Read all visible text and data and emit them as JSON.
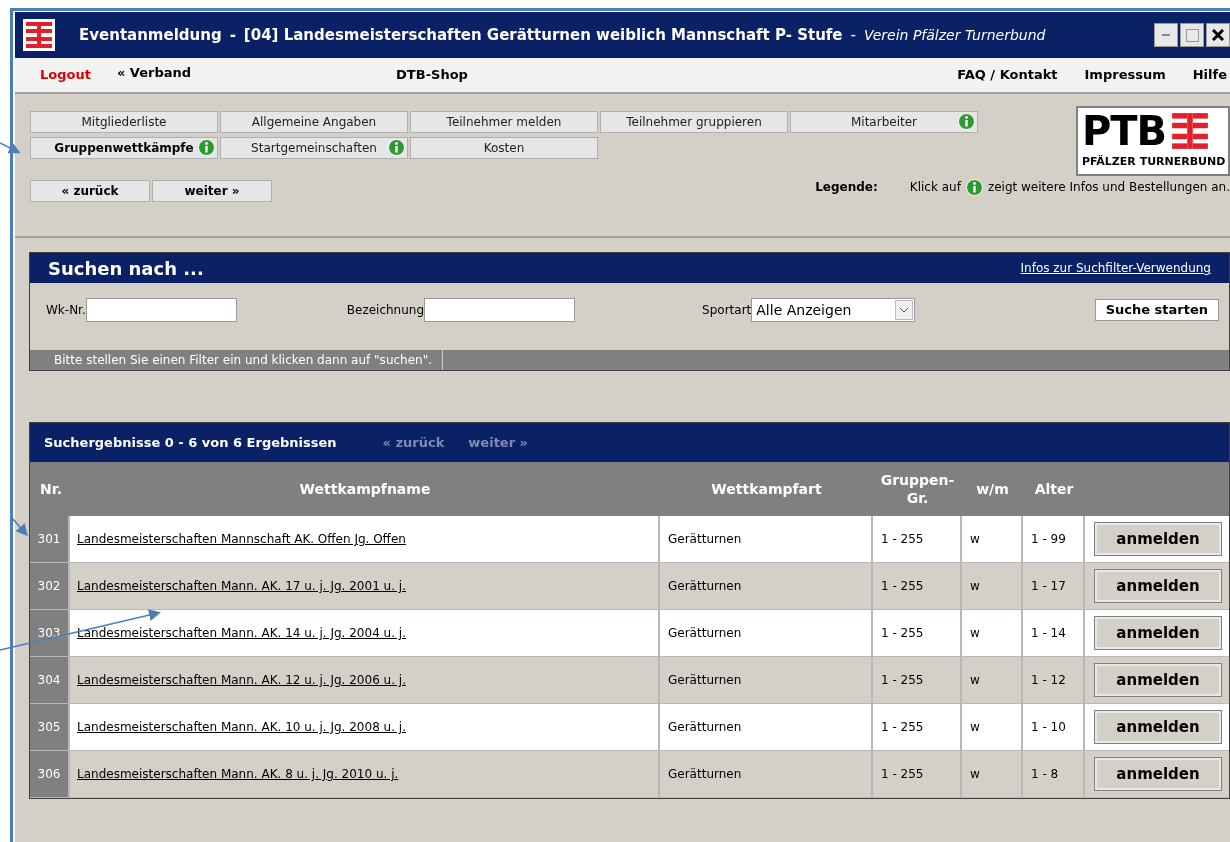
{
  "window": {
    "title": "Eventanmeldung",
    "separator": "-",
    "event": "[04] Landesmeisterschaften Gerätturnen weiblich Mannschaft P- Stufe",
    "separator_2": "-",
    "club": "Verein Pfälzer Turnerbund"
  },
  "menu": [
    {
      "label": "Logout",
      "kind": "logout"
    },
    {
      "label": "« Verband",
      "kind": "link"
    },
    {
      "label": "DTB-Shop",
      "kind": "center"
    },
    {
      "label": "FAQ / Kontakt",
      "kind": "right"
    },
    {
      "label": "Impressum",
      "kind": "right"
    },
    {
      "label": "Hilfe",
      "kind": "right"
    }
  ],
  "tabs": [
    {
      "label": "Mitgliederliste",
      "selected": false,
      "info": false
    },
    {
      "label": "Allgemeine Angaben",
      "selected": false,
      "info": false
    },
    {
      "label": "Teilnehmer melden",
      "selected": false,
      "info": false
    },
    {
      "label": "Teilnehmer gruppieren",
      "selected": false,
      "info": false
    },
    {
      "label": "Mitarbeiter",
      "selected": false,
      "info": true
    },
    {
      "label": "Gruppenwettkämpfe",
      "selected": true,
      "info": true
    },
    {
      "label": "Startgemeinschaften",
      "selected": false,
      "info": true
    },
    {
      "label": "Kosten",
      "selected": false,
      "info": false
    }
  ],
  "logo": {
    "letters": "PTB",
    "caption": "PFÄLZER TURNERBUND"
  },
  "nav_buttons": [
    "« zurück",
    "weiter »"
  ],
  "legend": {
    "label": "Legende:",
    "before": "Klick auf",
    "after": "zeigt weitere Infos und Bestellungen an."
  },
  "search": {
    "title": "Suchen nach ...",
    "help_link": "Infos zur Suchfilter-Verwendung",
    "fields": [
      {
        "label": "Wk-Nr.",
        "kind": "text"
      },
      {
        "label": "Bezeichnung",
        "kind": "text"
      },
      {
        "label": "Sportart",
        "kind": "select",
        "value": "Alle Anzeigen"
      }
    ],
    "button": "Suche starten",
    "hint": "Bitte stellen Sie einen Filter ein und klicken dann auf \"suchen\"."
  },
  "results": {
    "title": "Suchergebnisse 0 - 6 von 6 Ergebnissen",
    "prev": "« zurück",
    "next": "weiter »",
    "columns": [
      "Nr.",
      "Wettkampfname",
      "Wettkampfart",
      "Gruppen-\nGr.",
      "w/m",
      "Alter"
    ],
    "rows": [
      {
        "nr": "301",
        "name": "Landesmeisterschaften Mannschaft AK. Offen Jg. Offen",
        "type": "Gerätturnen",
        "group": "1 - 255",
        "sex": "w",
        "age": "1 - 99",
        "button": "anmelden"
      },
      {
        "nr": "302",
        "name": "Landesmeisterschaften Mann. AK. 17 u. j. Jg. 2001 u. j.",
        "type": "Gerätturnen",
        "group": "1 - 255",
        "sex": "w",
        "age": "1 - 17",
        "button": "anmelden"
      },
      {
        "nr": "303",
        "name": "Landesmeisterschaften Mann. AK. 14 u. j. Jg. 2004 u. j.",
        "type": "Gerätturnen",
        "group": "1 - 255",
        "sex": "w",
        "age": "1 - 14",
        "button": "anmelden"
      },
      {
        "nr": "304",
        "name": "Landesmeisterschaften Mann. AK. 12 u. j. Jg. 2006 u. j.",
        "type": "Gerätturnen",
        "group": "1 - 255",
        "sex": "w",
        "age": "1 - 12",
        "button": "anmelden"
      },
      {
        "nr": "305",
        "name": "Landesmeisterschaften Mann. AK. 10 u. j. Jg. 2008 u. j.",
        "type": "Gerätturnen",
        "group": "1 - 255",
        "sex": "w",
        "age": "1 - 10",
        "button": "anmelden"
      },
      {
        "nr": "306",
        "name": "Landesmeisterschaften Mann. AK. 8 u. j. Jg. 2010 u. j.",
        "type": "Gerätturnen",
        "group": "1 - 255",
        "sex": "w",
        "age": "1 - 8",
        "button": "anmelden"
      }
    ]
  }
}
